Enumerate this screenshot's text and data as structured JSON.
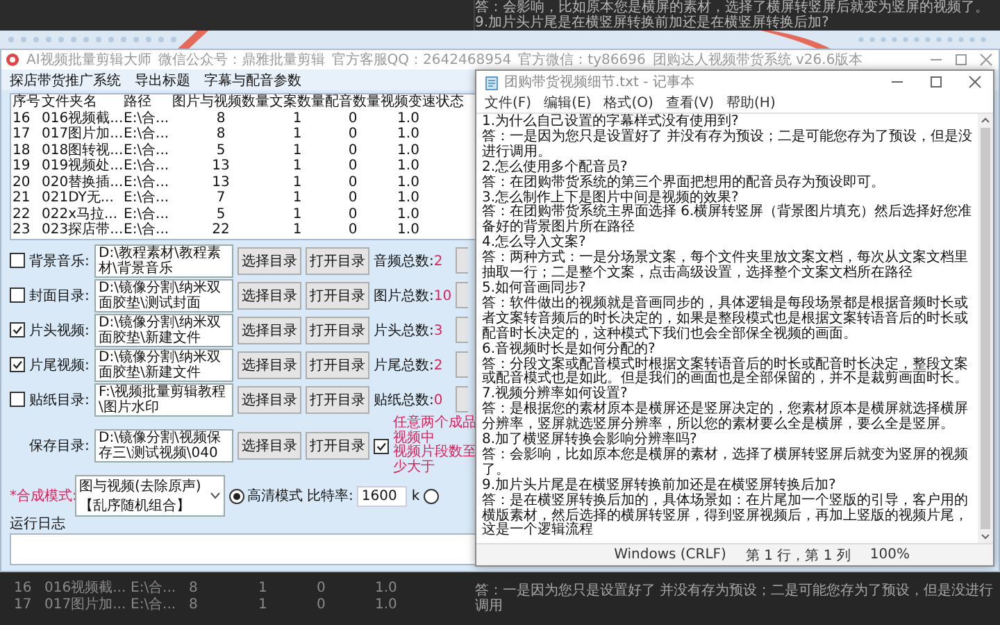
{
  "background_top": {
    "lines": [
      "答：会影响，比如原本您是横屏的素材，选择了横屏转竖屏后就变为竖屏的视频了。",
      "9.加片头片尾是在横竖屏转换前加还是在横竖屏转换后加?"
    ]
  },
  "app": {
    "title": "AI视频批量剪辑大师",
    "title_info": [
      "微信公众号：鼎雅批量剪辑",
      "官方客服QQ：2642468954",
      "官方微信：ty86696"
    ],
    "second_title": "团购达人视频带货系统  v26.6版本",
    "menu": [
      "探店带货推广系统",
      "导出标题",
      "字幕与配音参数"
    ],
    "table": {
      "columns": [
        "序号",
        "文件夹名",
        "路径",
        "图片与视频数量",
        "文案数量",
        "配音数量",
        "视频变速",
        "状态"
      ],
      "rows": [
        [
          "16",
          "016视频截...",
          "E:\\合...",
          "8",
          "1",
          "0",
          "1.0"
        ],
        [
          "17",
          "017图片加...",
          "E:\\合...",
          "8",
          "1",
          "0",
          "1.0"
        ],
        [
          "18",
          "018图转视...",
          "E:\\合...",
          "5",
          "1",
          "0",
          "1.0"
        ],
        [
          "19",
          "019视频处...",
          "E:\\合...",
          "13",
          "1",
          "0",
          "1.0"
        ],
        [
          "20",
          "020替换插...",
          "E:\\合...",
          "13",
          "1",
          "0",
          "1.0"
        ],
        [
          "21",
          "021DY无...",
          "E:\\合...",
          "7",
          "1",
          "0",
          "1.0"
        ],
        [
          "22",
          "022x马拉...",
          "E:\\合...",
          "5",
          "1",
          "0",
          "1.0"
        ],
        [
          "23",
          "023探店带...",
          "E:\\合...",
          "22",
          "1",
          "0",
          "1.0"
        ]
      ]
    },
    "folder_rows": [
      {
        "checked": false,
        "label": "背景音乐:",
        "path": "D:\\教程素材\\教程素材\\背景音乐",
        "buttons": [
          "选择目录",
          "打开目录"
        ],
        "count_label": "音频总数:",
        "count": "2"
      },
      {
        "checked": false,
        "label": "封面目录:",
        "path": "D:\\镜像分割\\纳米双面胶垫\\测试封面",
        "buttons": [
          "选择目录",
          "打开目录"
        ],
        "count_label": "图片总数:",
        "count": "10"
      },
      {
        "checked": true,
        "label": "片头视频:",
        "path": "D:\\镜像分割\\纳米双面胶垫\\新建文件",
        "buttons": [
          "选择目录",
          "打开目录"
        ],
        "count_label": "片头总数:",
        "count": "3"
      },
      {
        "checked": true,
        "label": "片尾视频:",
        "path": "D:\\镜像分割\\纳米双面胶垫\\新建文件",
        "buttons": [
          "选择目录",
          "打开目录"
        ],
        "count_label": "片尾总数:",
        "count": "2"
      },
      {
        "checked": false,
        "label": "贴纸目录:",
        "path": "F:\\视频批量剪辑教程\\图片水印",
        "buttons": [
          "选择目录",
          "打开目录"
        ],
        "count_label": "贴纸总数:",
        "count": "0"
      }
    ],
    "save_row": {
      "label": "保存目录:",
      "path": "D:\\镜像分割\\视频保存三\\测试视频\\040",
      "buttons": [
        "选择目录",
        "打开目录"
      ],
      "option_checked": true,
      "note_lines": [
        "任意两个成品视频中",
        "视频片段数至少大于"
      ]
    },
    "mode": {
      "label": "*合成模式:",
      "value": "图与视频(去除原声)【乱序随机组合】"
    },
    "radios": [
      {
        "label": "高清模式",
        "selected": true
      },
      {
        "selected": false
      }
    ],
    "bitrate": {
      "label": "比特率:",
      "value": "1600",
      "unit": "k"
    },
    "log": {
      "label": "运行日志"
    }
  },
  "notepad": {
    "title": "团购带货视频细节.txt - 记事本",
    "menu": [
      "文件(F)",
      "编辑(E)",
      "格式(O)",
      "查看(V)",
      "帮助(H)"
    ],
    "paragraphs": [
      "1.为什么自己设置的字幕样式没有使用到?",
      "答：一是因为您只是设置好了 并没有存为预设；二是可能您存为了预设，但是没进行调用。",
      "2.怎么使用多个配音员?",
      "答：在团购带货系统的第三个界面把想用的配音员存为预设即可。",
      "3.怎么制作上下是图片中间是视频的效果?",
      "答：在团购带货系统主界面选择 6.横屏转竖屏（背景图片填充）然后选择好您准备好的背景图片所在路径",
      "4.怎么导入文案?",
      "答：两种方式：一是分场景文案，每个文件夹里放文案文档，每次从文案文档里抽取一行；二是整个文案，点击高级设置，选择整个文案文档所在路径",
      "5.如何音画同步?",
      "答：软件做出的视频就是音画同步的，具体逻辑是每段场景都是根据音频时长或者文案转音频后的时长决定的，如果是整段模式也是根据文案转语音后的时长或配音时长决定的，这种模式下我们也会全部保全视频的画面。",
      "6.音视频时长是如何分配的?",
      "答：分段文案或配音模式时根据文案转语音后的时长或配音时长决定，整段文案或配音模式也是如此。但是我们的画面也是全部保留的，并不是裁剪画面时长。",
      "7.视频分辨率如何设置?",
      "答：是根据您的素材原本是横屏还是竖屏决定的，您素材原本是横屏就选择横屏分辨率，竖屏就选竖屏分辨率，所以您的素材要么全是横屏，要么全是竖屏。",
      "8.加了横竖屏转换会影响分辨率吗?",
      "答：会影响，比如原本您是横屏的素材，选择了横屏转竖屏后就变为竖屏的视频了。",
      "9.加片头片尾是在横竖屏转换前加还是在横竖屏转换后加?",
      "答：是在横竖屏转换后加的，具体场景如：在片尾加一个竖版的引导，客户用的横版素材，然后选择的横屏转竖屏，得到竖屏视频后，再加上竖版的视频片尾，这是一个逻辑流程"
    ],
    "status": [
      "Windows (CRLF)",
      "第 1 行，第 1 列",
      "100%"
    ]
  },
  "background_bottom": {
    "rows": [
      [
        "16",
        "016视频截...",
        "E:\\合...",
        "8",
        "1",
        "0",
        "1.0"
      ],
      [
        "17",
        "017图片加...",
        "E:\\合...",
        "8",
        "1",
        "0",
        "1.0"
      ]
    ],
    "text": "答：一是因为您只是设置好了 并没有存为预设；二是可能您存为了预设，但是没进行调用"
  }
}
